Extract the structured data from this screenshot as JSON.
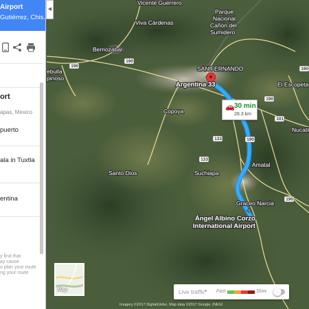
{
  "panel": {
    "header_title": "Airport",
    "header_subtitle": "Gutiérrez, Chis...",
    "origin_title": "ort",
    "origin_sub": "apas, Mexico",
    "item_1": "puerto",
    "item_2": "ala in Tuxtla",
    "item_3": "entina",
    "tip_lines": [
      "y find that",
      "ay cause",
      "o plan your route",
      "ng your route"
    ],
    "icons": [
      "phone-icon",
      "share-icon",
      "print-icon"
    ]
  },
  "map": {
    "labels": {
      "vicente_guerrero": "Vicente Guerrero",
      "parque_1": "Parque",
      "parque_2": "Nacional",
      "parque_3": "Cañón del",
      "parque_4": "Sumidero",
      "viva_cardenas": "Viva Cárdenas",
      "berriozabal": "Berriozábal",
      "san_fernando": "SAN FERNANDO",
      "argentina": "Argentina 33",
      "el_escopeta": "El Escopeta",
      "copoya": "Copoya",
      "nucatili": "Nucatili",
      "ebullo": "ebulla",
      "pinoso": "pinoso",
      "amatal": "Amatal",
      "santo_dios": "Santo Dios",
      "suchiapa": "Suchiapa",
      "chiapa_de_corzo": "Chiapa de C...",
      "graceo_narcia": "Graceo Narcia",
      "airport_1": "Ángel Albino Corzo",
      "airport_2": "International Airport",
      "route_shields": [
        "190",
        "133",
        "190",
        "101",
        "133",
        "190",
        "190",
        "190",
        "190"
      ]
    },
    "route": {
      "time": "30 min",
      "distance": "28.3 km",
      "color": "#2aa3f0"
    }
  },
  "minimap": {
    "label": "Map"
  },
  "traffic": {
    "label": "Live traffic",
    "fast": "Fast",
    "slow": "Slow",
    "colors": [
      "#6cc24a",
      "#f2a33a",
      "#e53935",
      "#8b1a1a"
    ]
  },
  "attribution": "Imagery ©2017 DigitalGlobe, Map data ©2017 Google, INEGI"
}
